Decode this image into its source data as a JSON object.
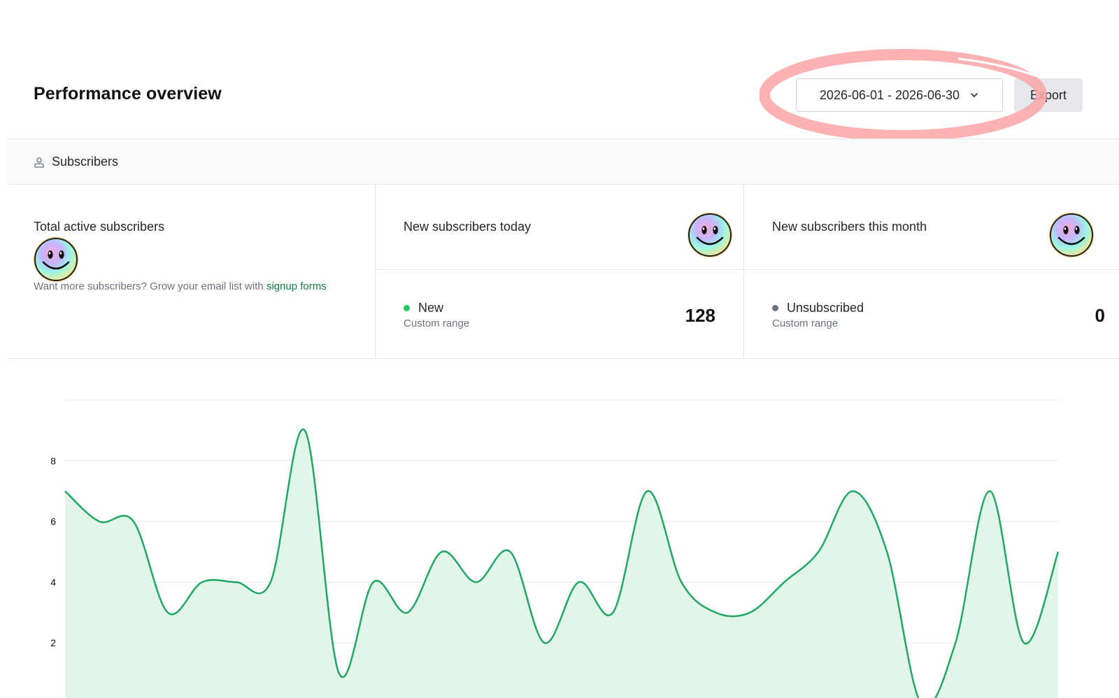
{
  "header": {
    "title": "Performance overview",
    "date_range": "2026-06-01 - 2026-06-30",
    "export_label": "Export"
  },
  "tabs": [
    {
      "label": "Subscribers",
      "icon": "user-icon"
    }
  ],
  "stats": {
    "total": {
      "label": "Total active subscribers",
      "hint_prefix": "Want more subscribers? Grow your email list with ",
      "hint_link": "signup forms"
    },
    "today": {
      "label": "New subscribers today",
      "metric_name": "New",
      "metric_sub": "Custom range",
      "value": "128",
      "dot_color": "#22c55e"
    },
    "month": {
      "label": "New subscribers this month",
      "metric_name": "Unsubscribed",
      "metric_sub": "Custom range",
      "value": "0",
      "dot_color": "#6b7280"
    }
  },
  "chart_data": {
    "type": "area",
    "y_ticks": [
      2,
      4,
      6,
      8
    ],
    "ylim": [
      0,
      10
    ],
    "values": [
      7,
      6,
      6,
      3,
      4,
      4,
      4,
      9,
      1,
      4,
      3,
      5,
      4,
      5,
      2,
      4,
      3,
      7,
      4,
      3,
      3,
      4,
      5,
      7,
      5,
      0,
      2,
      7,
      2,
      5
    ],
    "line_color": "#1fa863",
    "fill_color": "#e1f5e8",
    "grid": true
  }
}
